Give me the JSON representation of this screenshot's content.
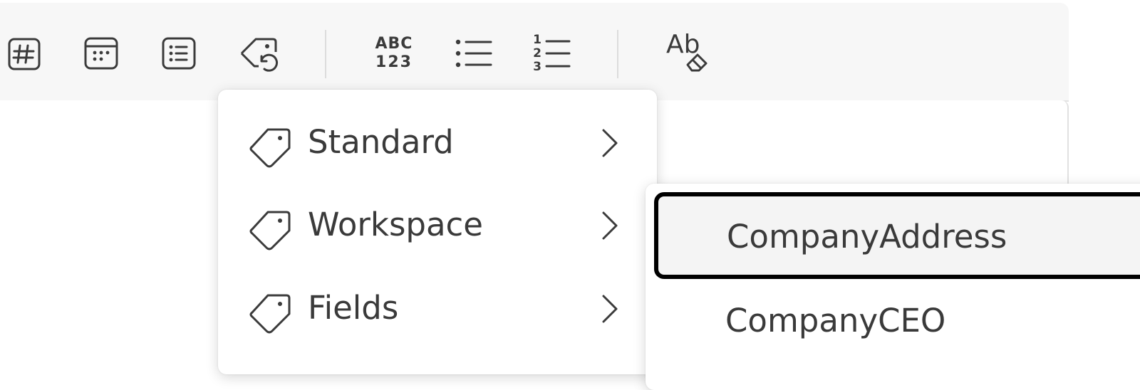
{
  "toolbar": {
    "buttons": [
      {
        "icon": "number-field-icon"
      },
      {
        "icon": "date-picker-icon"
      },
      {
        "icon": "list-box-icon"
      },
      {
        "icon": "insert-tag-icon"
      },
      {
        "icon": "text-case-icon"
      },
      {
        "icon": "bullet-list-icon"
      },
      {
        "icon": "numbered-list-icon"
      },
      {
        "icon": "clear-formatting-icon"
      }
    ],
    "abc_text": "ABC",
    "num_text": "123",
    "list_numbers": [
      "1",
      "2",
      "3"
    ],
    "clear_format_text": "Ab"
  },
  "menu": {
    "items": [
      {
        "label": "Standard",
        "icon": "tag-icon"
      },
      {
        "label": "Workspace",
        "icon": "tag-icon"
      },
      {
        "label": "Fields",
        "icon": "tag-icon"
      }
    ]
  },
  "submenu": {
    "items": [
      {
        "label": "CompanyAddress",
        "focused": true
      },
      {
        "label": "CompanyCEO",
        "focused": false
      }
    ]
  }
}
